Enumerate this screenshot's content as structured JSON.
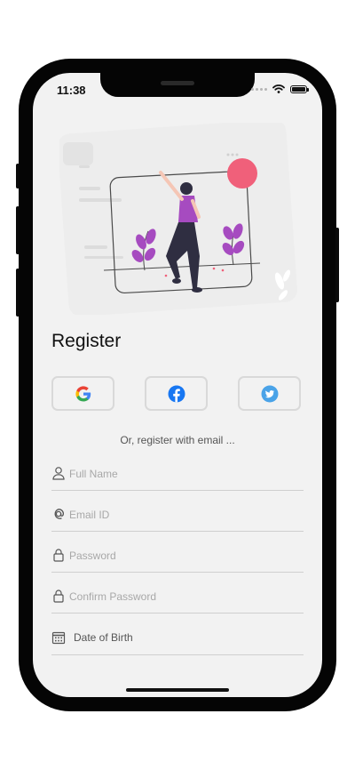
{
  "status_bar": {
    "time": "11:38"
  },
  "page": {
    "title": "Register"
  },
  "social": {
    "google": "Google",
    "facebook": "Facebook",
    "twitter": "Twitter"
  },
  "divider_text": "Or, register with email ...",
  "form": {
    "full_name": {
      "placeholder": "Full Name",
      "icon": "person-icon"
    },
    "email": {
      "placeholder": "Email ID",
      "icon": "at-sign-icon"
    },
    "password": {
      "placeholder": "Password",
      "icon": "lock-icon"
    },
    "confirm_password": {
      "placeholder": "Confirm Password",
      "icon": "lock-icon"
    },
    "dob": {
      "label": "Date of Birth",
      "icon": "calendar-icon"
    }
  },
  "colors": {
    "background": "#f2f2f2",
    "accent_purple": "#a64bc0",
    "accent_pink": "#f0607a",
    "facebook_blue": "#1877f2",
    "twitter_blue": "#4aa3e8"
  }
}
